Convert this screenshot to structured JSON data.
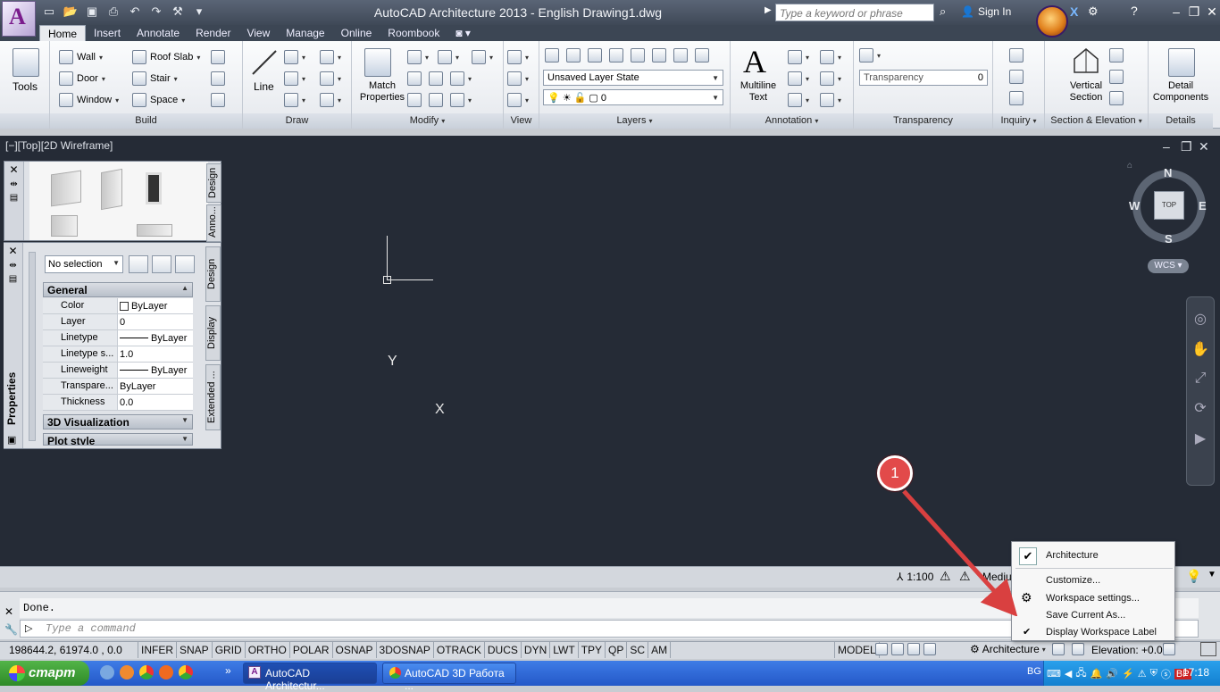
{
  "window": {
    "title": "AutoCAD Architecture 2013 - English    Drawing1.dwg",
    "search_placeholder": "Type a keyword or phrase",
    "sign_in": "Sign In",
    "logo_letter": "A"
  },
  "tabs": [
    "Home",
    "Insert",
    "Annotate",
    "Render",
    "View",
    "Manage",
    "Online",
    "Roombook"
  ],
  "ribbon": {
    "tools": {
      "label": "Tools"
    },
    "build": {
      "title": "Build",
      "wall": "Wall",
      "door": "Door",
      "window": "Window",
      "roof_slab": "Roof Slab",
      "stair": "Stair",
      "space": "Space"
    },
    "draw": {
      "title": "Draw",
      "line": "Line"
    },
    "modify": {
      "title": "Modify",
      "match_properties": "Match Properties"
    },
    "view": {
      "title": "View"
    },
    "layers": {
      "title": "Layers",
      "layer_state": "Unsaved Layer State",
      "current_layer": "0"
    },
    "annotation": {
      "title": "Annotation",
      "multiline_text": "Multiline Text"
    },
    "transparency": {
      "title": "Transparency",
      "label": "Transparency",
      "value": "0"
    },
    "inquiry": {
      "title": "Inquiry"
    },
    "section": {
      "title": "Section & Elevation",
      "vertical_section": "Vertical Section"
    },
    "details": {
      "title": "Details",
      "detail_components": "Detail Components"
    }
  },
  "viewport": {
    "label": "[−][Top][2D Wireframe]",
    "compass": {
      "n": "N",
      "s": "S",
      "e": "E",
      "w": "W",
      "top": "TOP"
    },
    "wcs": "WCS",
    "ucs_x": "X",
    "ucs_y": "Y"
  },
  "tool_palette": {
    "tabs": [
      "Design",
      "Anno..."
    ]
  },
  "properties": {
    "title": "Properties",
    "selection": "No selection",
    "tabs": [
      "Design",
      "Display",
      "Extended ..."
    ],
    "general": "General",
    "rows": [
      {
        "name": "Color",
        "value": "ByLayer"
      },
      {
        "name": "Layer",
        "value": "0"
      },
      {
        "name": "Linetype",
        "value": "ByLayer"
      },
      {
        "name": "Linetype s...",
        "value": "1.0"
      },
      {
        "name": "Lineweight",
        "value": "ByLayer"
      },
      {
        "name": "Transpare...",
        "value": "ByLayer"
      },
      {
        "name": "Thickness",
        "value": "0.0"
      }
    ],
    "viz": "3D Visualization",
    "plot": "Plot style"
  },
  "model_strip": {
    "scale": "1:100",
    "detail": "Mediu"
  },
  "command": {
    "history": "Done.",
    "placeholder": "Type a command"
  },
  "status": {
    "coords": "198644.2, 61974.0 , 0.0",
    "toggles": [
      "INFER",
      "SNAP",
      "GRID",
      "ORTHO",
      "POLAR",
      "OSNAP",
      "3DOSNAP",
      "OTRACK",
      "DUCS",
      "DYN",
      "LWT",
      "TPY",
      "QP",
      "SC",
      "AM"
    ],
    "model": "MODEL",
    "workspace": "Architecture",
    "elevation": "Elevation: +0.0"
  },
  "popup": {
    "items": [
      "Architecture",
      "Customize...",
      "Workspace settings...",
      "Save Current As...",
      "Display Workspace Label"
    ]
  },
  "annotation_marker": "1",
  "taskbar": {
    "start": "старт",
    "tasks": [
      "AutoCAD Architectur...",
      "AutoCAD 3D Работа ..."
    ],
    "lang": "BG",
    "clock": "17:18"
  }
}
